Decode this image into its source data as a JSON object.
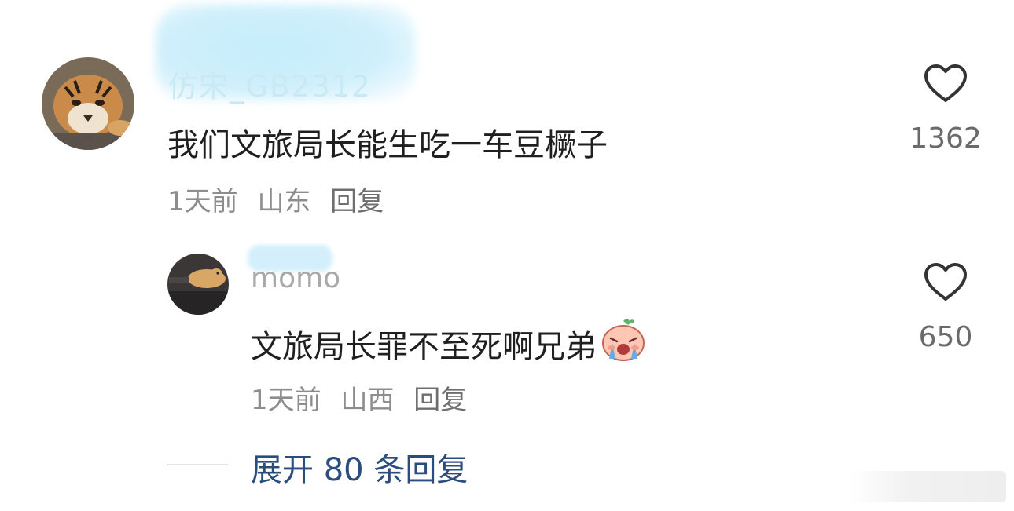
{
  "comment": {
    "username": "仿宋_GB2312",
    "text": "我们文旅局长能生吃一车豆橛子",
    "time": "1天前",
    "location": "山东",
    "reply_label": "回复",
    "likes": "1362"
  },
  "reply": {
    "username": "momo",
    "text": "文旅局长罪不至死啊兄弟",
    "emoji": "crying-face-emoji",
    "time": "1天前",
    "location": "山西",
    "reply_label": "回复",
    "likes": "650"
  },
  "expand": {
    "label": "展开 80 条回复"
  },
  "colors": {
    "text": "#1f1f1f",
    "meta": "#8d8d8d",
    "link": "#2b4d7e",
    "blur": "#c6eefb"
  }
}
